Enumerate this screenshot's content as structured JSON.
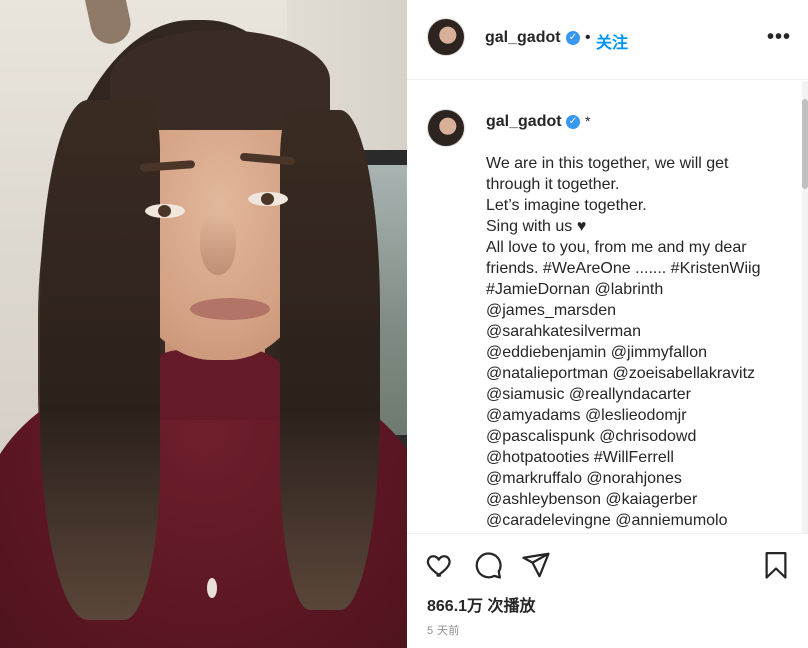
{
  "header": {
    "username": "gal_gadot",
    "verified_mark": "✓",
    "separator": "•",
    "follow_label": "关注",
    "more_label": "•••"
  },
  "post": {
    "username": "gal_gadot",
    "verified_mark": "✓",
    "extra_mark": "*",
    "caption_lines": [
      "We are in this together, we will get",
      "through it together.",
      "Let’s imagine together.",
      "Sing with us ♥",
      "All love to you, from me and my dear",
      "friends. #WeAreOne ....... #KristenWiig",
      "#JamieDornan @labrinth",
      "@james_marsden",
      "@sarahkatesilverman",
      "@eddiebenjamin @jimmyfallon",
      "@natalieportman @zoeisabellakravitz",
      "@siamusic @reallyndacarter",
      "@amyadams @leslieodomjr",
      "@pascalispunk @chrisodowd",
      "@hotpatooties #WillFerrell",
      "@markruffalo @norahjones",
      "@ashleybenson @kaiagerber",
      "@caradelevingne @anniemumolo"
    ]
  },
  "actions": {
    "icons": [
      "heart-icon",
      "comment-icon",
      "share-icon",
      "bookmark-icon"
    ],
    "views": "866.1万 次播放",
    "time_ago": "5 天前"
  },
  "colors": {
    "link_blue": "#0095f6",
    "verified_blue": "#3897f0",
    "muted_text": "#8e8e8e"
  }
}
